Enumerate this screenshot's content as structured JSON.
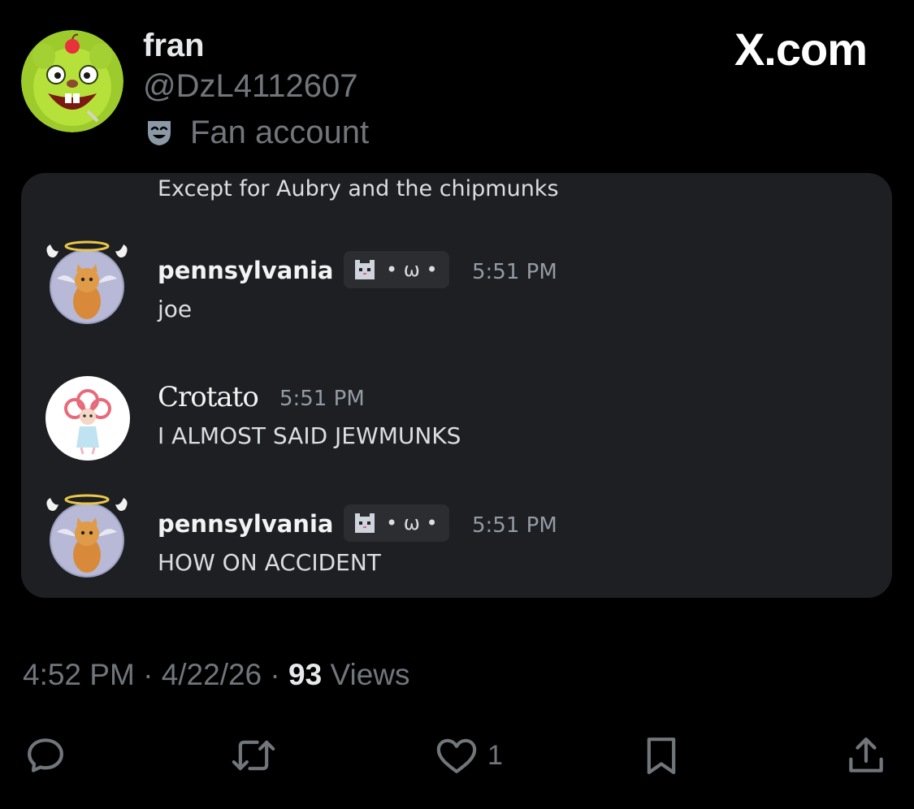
{
  "author": {
    "name": "fran",
    "handle": "@DzL4112607",
    "label": "Fan account",
    "label_icon": "theater-mask-icon"
  },
  "brand": "X.com",
  "embedded": {
    "overflow_text": "Except for Aubry and the chipmunks",
    "messages": [
      {
        "name": "pennsylvania",
        "tag": "• ω •",
        "time": "5:51 PM",
        "text": "joe",
        "avatar": "angel-kitten-avatar"
      },
      {
        "name": "Crotato",
        "time": "5:51 PM",
        "text": "I ALMOST SAID JEWMUNKS",
        "avatar": "anime-girl-avatar"
      },
      {
        "name": "pennsylvania",
        "tag": "• ω •",
        "time": "5:51 PM",
        "text": "HOW ON ACCIDENT",
        "avatar": "angel-kitten-avatar"
      }
    ]
  },
  "meta": {
    "time": "4:52 PM",
    "sep": "·",
    "date": "4/22/26",
    "views_count": "93",
    "views_label": "Views"
  },
  "actions": {
    "like_count": "1"
  },
  "colors": {
    "background": "#000000",
    "card": "#1e1f22",
    "muted": "#71767b"
  }
}
